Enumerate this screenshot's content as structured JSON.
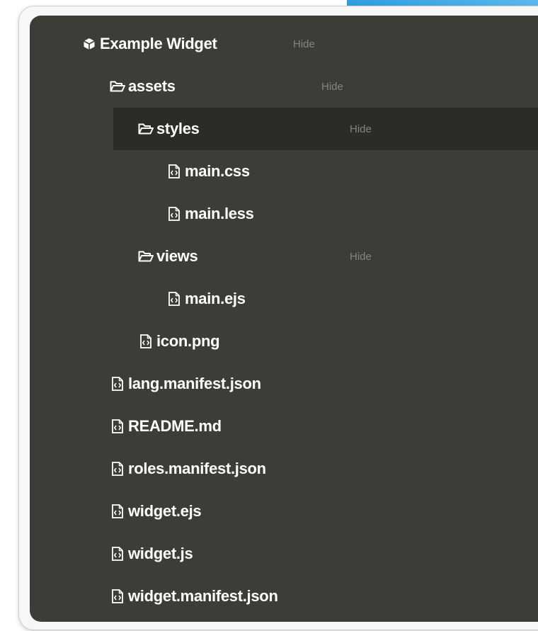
{
  "tree": {
    "hide_label": "Hide",
    "items": [
      {
        "name": "Example Widget",
        "icon": "cube-icon",
        "type": "root",
        "has_hide": true,
        "selected": false
      },
      {
        "name": "assets",
        "icon": "folder-open-icon",
        "type": "folder",
        "has_hide": true,
        "selected": false
      },
      {
        "name": "styles",
        "icon": "folder-open-icon",
        "type": "folder",
        "has_hide": true,
        "selected": true
      },
      {
        "name": "main.css",
        "icon": "file-code-icon",
        "type": "file",
        "has_hide": false,
        "selected": false
      },
      {
        "name": "main.less",
        "icon": "file-code-icon",
        "type": "file",
        "has_hide": false,
        "selected": false
      },
      {
        "name": "views",
        "icon": "folder-open-icon",
        "type": "folder",
        "has_hide": true,
        "selected": false
      },
      {
        "name": "main.ejs",
        "icon": "file-code-icon",
        "type": "file",
        "has_hide": false,
        "selected": false
      },
      {
        "name": "icon.png",
        "icon": "file-code-icon",
        "type": "file",
        "has_hide": false,
        "selected": false
      },
      {
        "name": "lang.manifest.json",
        "icon": "file-code-icon",
        "type": "file",
        "has_hide": false,
        "selected": false
      },
      {
        "name": "README.md",
        "icon": "file-code-icon",
        "type": "file",
        "has_hide": false,
        "selected": false
      },
      {
        "name": "roles.manifest.json",
        "icon": "file-code-icon",
        "type": "file",
        "has_hide": false,
        "selected": false
      },
      {
        "name": "widget.ejs",
        "icon": "file-code-icon",
        "type": "file",
        "has_hide": false,
        "selected": false
      },
      {
        "name": "widget.js",
        "icon": "file-code-icon",
        "type": "file",
        "has_hide": false,
        "selected": false
      },
      {
        "name": "widget.manifest.json",
        "icon": "file-code-icon",
        "type": "file",
        "has_hide": false,
        "selected": false
      }
    ]
  },
  "colors": {
    "panel_bg": "#3d3d38",
    "selected_bg": "#2b2b27",
    "text": "#ffffff",
    "hide_text": "#85857e",
    "accent": "#2f9fe0"
  }
}
